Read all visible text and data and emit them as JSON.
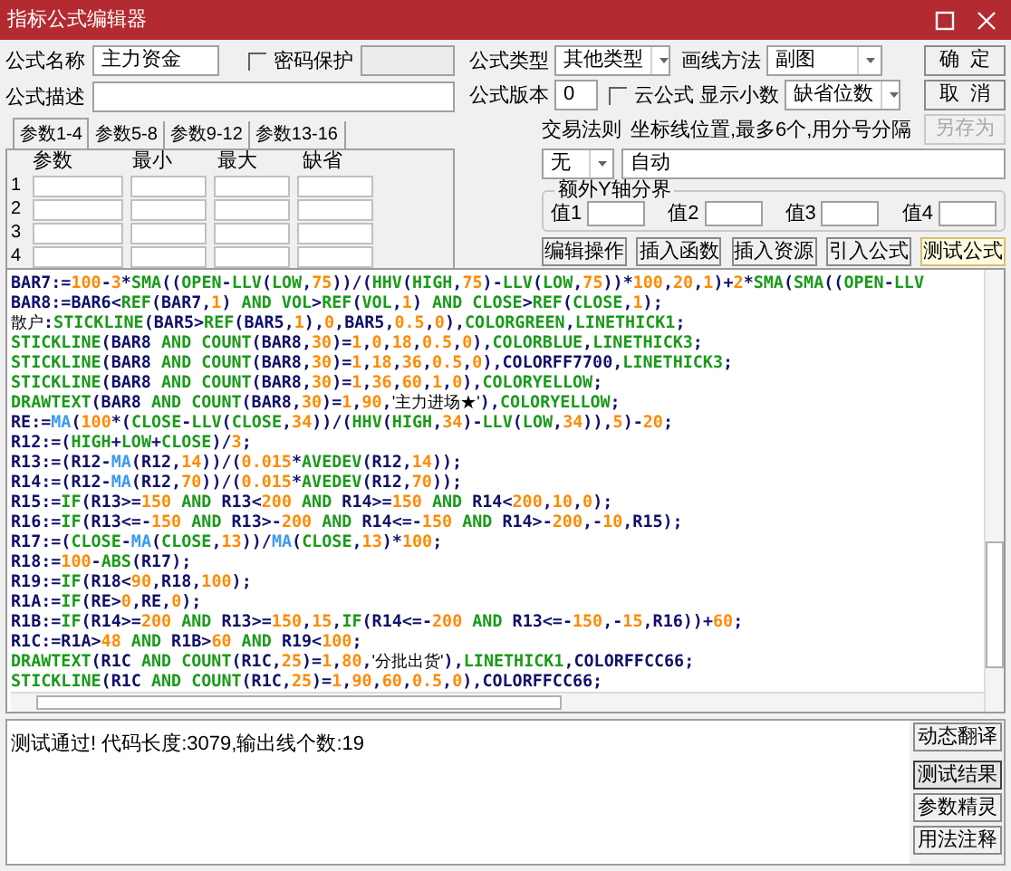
{
  "window": {
    "title": "指标公式编辑器"
  },
  "form": {
    "name_label": "公式名称",
    "name_value": "主力资金",
    "password": {
      "label": "密码保护",
      "checked": false
    },
    "desc_label": "公式描述",
    "type_label": "公式类型",
    "type_value": "其他类型",
    "draw_label": "画线方法",
    "draw_value": "副图",
    "version_label": "公式版本",
    "version_value": "0",
    "cloud": {
      "label": "云公式",
      "checked": false
    },
    "decimal_label": "显示小数",
    "decimal_value": "缺省位数",
    "trade_label": "交易法则",
    "trade_value": "无",
    "axis_label": "坐标线位置,最多6个,用分号分隔",
    "axis_value": "自动",
    "yaxis_title": "额外Y轴分界",
    "yaxis_values": [
      "值1",
      "值2",
      "值3",
      "值4"
    ]
  },
  "side_buttons": [
    {
      "label": "确  定",
      "disabled": false
    },
    {
      "label": "取  消",
      "disabled": false
    },
    {
      "label": "另存为",
      "disabled": true
    }
  ],
  "tabs": [
    {
      "label": "参数1-4",
      "selected": true
    },
    {
      "label": "参数5-8",
      "selected": false
    },
    {
      "label": "参数9-12",
      "selected": false
    },
    {
      "label": "参数13-16",
      "selected": false
    }
  ],
  "params": {
    "columns": [
      "参数",
      "最小",
      "最大",
      "缺省"
    ],
    "rows": [
      "1",
      "2",
      "3",
      "4"
    ]
  },
  "tool_buttons": [
    {
      "label": "编辑操作",
      "selected": false
    },
    {
      "label": "插入函数",
      "selected": false
    },
    {
      "label": "插入资源",
      "selected": false
    },
    {
      "label": "引入公式",
      "selected": false
    },
    {
      "label": "测试公式",
      "selected": true
    }
  ],
  "code": [
    [
      {
        "kind": "plain",
        "text": "BAR7:="
      },
      {
        "kind": "num",
        "text": "100"
      },
      {
        "kind": "plain",
        "text": "-"
      },
      {
        "kind": "num",
        "text": "3"
      },
      {
        "kind": "plain",
        "text": "*"
      },
      {
        "kind": "func",
        "text": "SMA"
      },
      {
        "kind": "plain",
        "text": "(("
      },
      {
        "kind": "func",
        "text": "OPEN"
      },
      {
        "kind": "plain",
        "text": "-"
      },
      {
        "kind": "func",
        "text": "LLV"
      },
      {
        "kind": "plain",
        "text": "("
      },
      {
        "kind": "func",
        "text": "LOW"
      },
      {
        "kind": "plain",
        "text": ","
      },
      {
        "kind": "num",
        "text": "75"
      },
      {
        "kind": "plain",
        "text": "))/("
      },
      {
        "kind": "func",
        "text": "HHV"
      },
      {
        "kind": "plain",
        "text": "("
      },
      {
        "kind": "func",
        "text": "HIGH"
      },
      {
        "kind": "plain",
        "text": ","
      },
      {
        "kind": "num",
        "text": "75"
      },
      {
        "kind": "plain",
        "text": ")-"
      },
      {
        "kind": "func",
        "text": "LLV"
      },
      {
        "kind": "plain",
        "text": "("
      },
      {
        "kind": "func",
        "text": "LOW"
      },
      {
        "kind": "plain",
        "text": ","
      },
      {
        "kind": "num",
        "text": "75"
      },
      {
        "kind": "plain",
        "text": "))*"
      },
      {
        "kind": "num",
        "text": "100"
      },
      {
        "kind": "plain",
        "text": ","
      },
      {
        "kind": "num",
        "text": "20"
      },
      {
        "kind": "plain",
        "text": ","
      },
      {
        "kind": "num",
        "text": "1"
      },
      {
        "kind": "plain",
        "text": ")+"
      },
      {
        "kind": "num",
        "text": "2"
      },
      {
        "kind": "plain",
        "text": "*"
      },
      {
        "kind": "func",
        "text": "SMA"
      },
      {
        "kind": "plain",
        "text": "("
      },
      {
        "kind": "func",
        "text": "SMA"
      },
      {
        "kind": "plain",
        "text": "(("
      },
      {
        "kind": "func",
        "text": "OPEN"
      },
      {
        "kind": "plain",
        "text": "-"
      },
      {
        "kind": "func",
        "text": "LLV"
      }
    ],
    [
      {
        "kind": "plain",
        "text": "BAR8:=BAR6<"
      },
      {
        "kind": "func",
        "text": "REF"
      },
      {
        "kind": "plain",
        "text": "(BAR7,"
      },
      {
        "kind": "num",
        "text": "1"
      },
      {
        "kind": "plain",
        "text": ") "
      },
      {
        "kind": "func",
        "text": "AND VOL"
      },
      {
        "kind": "plain",
        "text": ">"
      },
      {
        "kind": "func",
        "text": "REF"
      },
      {
        "kind": "plain",
        "text": "("
      },
      {
        "kind": "func",
        "text": "VOL"
      },
      {
        "kind": "plain",
        "text": ","
      },
      {
        "kind": "num",
        "text": "1"
      },
      {
        "kind": "plain",
        "text": ") "
      },
      {
        "kind": "func",
        "text": "AND CLOSE"
      },
      {
        "kind": "plain",
        "text": ">"
      },
      {
        "kind": "func",
        "text": "REF"
      },
      {
        "kind": "plain",
        "text": "("
      },
      {
        "kind": "func",
        "text": "CLOSE"
      },
      {
        "kind": "plain",
        "text": ","
      },
      {
        "kind": "num",
        "text": "1"
      },
      {
        "kind": "plain",
        "text": ");"
      }
    ],
    [
      {
        "kind": "str",
        "text": "散户"
      },
      {
        "kind": "plain",
        "text": ":"
      },
      {
        "kind": "func",
        "text": "STICKLINE"
      },
      {
        "kind": "plain",
        "text": "(BAR5>"
      },
      {
        "kind": "func",
        "text": "REF"
      },
      {
        "kind": "plain",
        "text": "(BAR5,"
      },
      {
        "kind": "num",
        "text": "1"
      },
      {
        "kind": "plain",
        "text": "),"
      },
      {
        "kind": "num",
        "text": "0"
      },
      {
        "kind": "plain",
        "text": ",BAR5,"
      },
      {
        "kind": "num",
        "text": "0.5"
      },
      {
        "kind": "plain",
        "text": ","
      },
      {
        "kind": "num",
        "text": "0"
      },
      {
        "kind": "plain",
        "text": "),"
      },
      {
        "kind": "func",
        "text": "COLORGREEN"
      },
      {
        "kind": "plain",
        "text": ","
      },
      {
        "kind": "func",
        "text": "LINETHICK1"
      },
      {
        "kind": "plain",
        "text": ";"
      }
    ],
    [
      {
        "kind": "func",
        "text": "STICKLINE"
      },
      {
        "kind": "plain",
        "text": "(BAR8 "
      },
      {
        "kind": "func",
        "text": "AND COUNT"
      },
      {
        "kind": "plain",
        "text": "(BAR8,"
      },
      {
        "kind": "num",
        "text": "30"
      },
      {
        "kind": "plain",
        "text": ")="
      },
      {
        "kind": "num",
        "text": "1"
      },
      {
        "kind": "plain",
        "text": ","
      },
      {
        "kind": "num",
        "text": "0"
      },
      {
        "kind": "plain",
        "text": ","
      },
      {
        "kind": "num",
        "text": "18"
      },
      {
        "kind": "plain",
        "text": ","
      },
      {
        "kind": "num",
        "text": "0.5"
      },
      {
        "kind": "plain",
        "text": ","
      },
      {
        "kind": "num",
        "text": "0"
      },
      {
        "kind": "plain",
        "text": "),"
      },
      {
        "kind": "func",
        "text": "COLORBLUE"
      },
      {
        "kind": "plain",
        "text": ","
      },
      {
        "kind": "func",
        "text": "LINETHICK3"
      },
      {
        "kind": "plain",
        "text": ";"
      }
    ],
    [
      {
        "kind": "func",
        "text": "STICKLINE"
      },
      {
        "kind": "plain",
        "text": "(BAR8 "
      },
      {
        "kind": "func",
        "text": "AND COUNT"
      },
      {
        "kind": "plain",
        "text": "(BAR8,"
      },
      {
        "kind": "num",
        "text": "30"
      },
      {
        "kind": "plain",
        "text": ")="
      },
      {
        "kind": "num",
        "text": "1"
      },
      {
        "kind": "plain",
        "text": ","
      },
      {
        "kind": "num",
        "text": "18"
      },
      {
        "kind": "plain",
        "text": ","
      },
      {
        "kind": "num",
        "text": "36"
      },
      {
        "kind": "plain",
        "text": ","
      },
      {
        "kind": "num",
        "text": "0.5"
      },
      {
        "kind": "plain",
        "text": ","
      },
      {
        "kind": "num",
        "text": "0"
      },
      {
        "kind": "plain",
        "text": "),COLORFF7700,"
      },
      {
        "kind": "func",
        "text": "LINETHICK3"
      },
      {
        "kind": "plain",
        "text": ";"
      }
    ],
    [
      {
        "kind": "func",
        "text": "STICKLINE"
      },
      {
        "kind": "plain",
        "text": "(BAR8 "
      },
      {
        "kind": "func",
        "text": "AND COUNT"
      },
      {
        "kind": "plain",
        "text": "(BAR8,"
      },
      {
        "kind": "num",
        "text": "30"
      },
      {
        "kind": "plain",
        "text": ")="
      },
      {
        "kind": "num",
        "text": "1"
      },
      {
        "kind": "plain",
        "text": ","
      },
      {
        "kind": "num",
        "text": "36"
      },
      {
        "kind": "plain",
        "text": ","
      },
      {
        "kind": "num",
        "text": "60"
      },
      {
        "kind": "plain",
        "text": ","
      },
      {
        "kind": "num",
        "text": "1"
      },
      {
        "kind": "plain",
        "text": ","
      },
      {
        "kind": "num",
        "text": "0"
      },
      {
        "kind": "plain",
        "text": "),"
      },
      {
        "kind": "func",
        "text": "COLORYELLOW"
      },
      {
        "kind": "plain",
        "text": ";"
      }
    ],
    [
      {
        "kind": "func",
        "text": "DRAWTEXT"
      },
      {
        "kind": "plain",
        "text": "(BAR8 "
      },
      {
        "kind": "func",
        "text": "AND COUNT"
      },
      {
        "kind": "plain",
        "text": "(BAR8,"
      },
      {
        "kind": "num",
        "text": "30"
      },
      {
        "kind": "plain",
        "text": ")="
      },
      {
        "kind": "num",
        "text": "1"
      },
      {
        "kind": "plain",
        "text": ","
      },
      {
        "kind": "num",
        "text": "90"
      },
      {
        "kind": "plain",
        "text": ","
      },
      {
        "kind": "str",
        "text": "'主力进场★'"
      },
      {
        "kind": "plain",
        "text": "),"
      },
      {
        "kind": "func",
        "text": "COLORYELLOW"
      },
      {
        "kind": "plain",
        "text": ";"
      }
    ],
    [
      {
        "kind": "plain",
        "text": "RE:="
      },
      {
        "kind": "ma",
        "text": "MA"
      },
      {
        "kind": "plain",
        "text": "("
      },
      {
        "kind": "num",
        "text": "100"
      },
      {
        "kind": "plain",
        "text": "*("
      },
      {
        "kind": "func",
        "text": "CLOSE"
      },
      {
        "kind": "plain",
        "text": "-"
      },
      {
        "kind": "func",
        "text": "LLV"
      },
      {
        "kind": "plain",
        "text": "("
      },
      {
        "kind": "func",
        "text": "CLOSE"
      },
      {
        "kind": "plain",
        "text": ","
      },
      {
        "kind": "num",
        "text": "34"
      },
      {
        "kind": "plain",
        "text": "))/("
      },
      {
        "kind": "func",
        "text": "HHV"
      },
      {
        "kind": "plain",
        "text": "("
      },
      {
        "kind": "func",
        "text": "HIGH"
      },
      {
        "kind": "plain",
        "text": ","
      },
      {
        "kind": "num",
        "text": "34"
      },
      {
        "kind": "plain",
        "text": ")-"
      },
      {
        "kind": "func",
        "text": "LLV"
      },
      {
        "kind": "plain",
        "text": "("
      },
      {
        "kind": "func",
        "text": "LOW"
      },
      {
        "kind": "plain",
        "text": ","
      },
      {
        "kind": "num",
        "text": "34"
      },
      {
        "kind": "plain",
        "text": ")),"
      },
      {
        "kind": "num",
        "text": "5"
      },
      {
        "kind": "plain",
        "text": ")-"
      },
      {
        "kind": "num",
        "text": "20"
      },
      {
        "kind": "plain",
        "text": ";"
      }
    ],
    [
      {
        "kind": "plain",
        "text": "R12:=("
      },
      {
        "kind": "func",
        "text": "HIGH"
      },
      {
        "kind": "plain",
        "text": "+"
      },
      {
        "kind": "func",
        "text": "LOW"
      },
      {
        "kind": "plain",
        "text": "+"
      },
      {
        "kind": "func",
        "text": "CLOSE"
      },
      {
        "kind": "plain",
        "text": ")/"
      },
      {
        "kind": "num",
        "text": "3"
      },
      {
        "kind": "plain",
        "text": ";"
      }
    ],
    [
      {
        "kind": "plain",
        "text": "R13:=(R12-"
      },
      {
        "kind": "ma",
        "text": "MA"
      },
      {
        "kind": "plain",
        "text": "(R12,"
      },
      {
        "kind": "num",
        "text": "14"
      },
      {
        "kind": "plain",
        "text": "))/("
      },
      {
        "kind": "num",
        "text": "0.015"
      },
      {
        "kind": "plain",
        "text": "*"
      },
      {
        "kind": "func",
        "text": "AVEDEV"
      },
      {
        "kind": "plain",
        "text": "(R12,"
      },
      {
        "kind": "num",
        "text": "14"
      },
      {
        "kind": "plain",
        "text": "));"
      }
    ],
    [
      {
        "kind": "plain",
        "text": "R14:=(R12-"
      },
      {
        "kind": "ma",
        "text": "MA"
      },
      {
        "kind": "plain",
        "text": "(R12,"
      },
      {
        "kind": "num",
        "text": "70"
      },
      {
        "kind": "plain",
        "text": "))/("
      },
      {
        "kind": "num",
        "text": "0.015"
      },
      {
        "kind": "plain",
        "text": "*"
      },
      {
        "kind": "func",
        "text": "AVEDEV"
      },
      {
        "kind": "plain",
        "text": "(R12,"
      },
      {
        "kind": "num",
        "text": "70"
      },
      {
        "kind": "plain",
        "text": "));"
      }
    ],
    [
      {
        "kind": "plain",
        "text": "R15:="
      },
      {
        "kind": "func",
        "text": "IF"
      },
      {
        "kind": "plain",
        "text": "(R13>="
      },
      {
        "kind": "num",
        "text": "150"
      },
      {
        "kind": "func",
        "text": " AND"
      },
      {
        "kind": "plain",
        "text": " R13<"
      },
      {
        "kind": "num",
        "text": "200"
      },
      {
        "kind": "func",
        "text": " AND"
      },
      {
        "kind": "plain",
        "text": " R14>="
      },
      {
        "kind": "num",
        "text": "150"
      },
      {
        "kind": "func",
        "text": " AND"
      },
      {
        "kind": "plain",
        "text": " R14<"
      },
      {
        "kind": "num",
        "text": "200"
      },
      {
        "kind": "plain",
        "text": ","
      },
      {
        "kind": "num",
        "text": "10"
      },
      {
        "kind": "plain",
        "text": ","
      },
      {
        "kind": "num",
        "text": "0"
      },
      {
        "kind": "plain",
        "text": ");"
      }
    ],
    [
      {
        "kind": "plain",
        "text": "R16:="
      },
      {
        "kind": "func",
        "text": "IF"
      },
      {
        "kind": "plain",
        "text": "(R13<=-"
      },
      {
        "kind": "num",
        "text": "150"
      },
      {
        "kind": "func",
        "text": " AND"
      },
      {
        "kind": "plain",
        "text": " R13>-"
      },
      {
        "kind": "num",
        "text": "200"
      },
      {
        "kind": "func",
        "text": " AND"
      },
      {
        "kind": "plain",
        "text": " R14<=-"
      },
      {
        "kind": "num",
        "text": "150"
      },
      {
        "kind": "func",
        "text": " AND"
      },
      {
        "kind": "plain",
        "text": " R14>-"
      },
      {
        "kind": "num",
        "text": "200"
      },
      {
        "kind": "plain",
        "text": ",-"
      },
      {
        "kind": "num",
        "text": "10"
      },
      {
        "kind": "plain",
        "text": ",R15);"
      }
    ],
    [
      {
        "kind": "plain",
        "text": "R17:=("
      },
      {
        "kind": "func",
        "text": "CLOSE"
      },
      {
        "kind": "plain",
        "text": "-"
      },
      {
        "kind": "ma",
        "text": "MA"
      },
      {
        "kind": "plain",
        "text": "("
      },
      {
        "kind": "func",
        "text": "CLOSE"
      },
      {
        "kind": "plain",
        "text": ","
      },
      {
        "kind": "num",
        "text": "13"
      },
      {
        "kind": "plain",
        "text": "))/"
      },
      {
        "kind": "ma",
        "text": "MA"
      },
      {
        "kind": "plain",
        "text": "("
      },
      {
        "kind": "func",
        "text": "CLOSE"
      },
      {
        "kind": "plain",
        "text": ","
      },
      {
        "kind": "num",
        "text": "13"
      },
      {
        "kind": "plain",
        "text": ")*"
      },
      {
        "kind": "num",
        "text": "100"
      },
      {
        "kind": "plain",
        "text": ";"
      }
    ],
    [
      {
        "kind": "plain",
        "text": "R18:="
      },
      {
        "kind": "num",
        "text": "100"
      },
      {
        "kind": "plain",
        "text": "-"
      },
      {
        "kind": "func",
        "text": "ABS"
      },
      {
        "kind": "plain",
        "text": "(R17);"
      }
    ],
    [
      {
        "kind": "plain",
        "text": "R19:="
      },
      {
        "kind": "func",
        "text": "IF"
      },
      {
        "kind": "plain",
        "text": "(R18<"
      },
      {
        "kind": "num",
        "text": "90"
      },
      {
        "kind": "plain",
        "text": ",R18,"
      },
      {
        "kind": "num",
        "text": "100"
      },
      {
        "kind": "plain",
        "text": ");"
      }
    ],
    [
      {
        "kind": "plain",
        "text": "R1A:="
      },
      {
        "kind": "func",
        "text": "IF"
      },
      {
        "kind": "plain",
        "text": "(RE>"
      },
      {
        "kind": "num",
        "text": "0"
      },
      {
        "kind": "plain",
        "text": ",RE,"
      },
      {
        "kind": "num",
        "text": "0"
      },
      {
        "kind": "plain",
        "text": ");"
      }
    ],
    [
      {
        "kind": "plain",
        "text": "R1B:="
      },
      {
        "kind": "func",
        "text": "IF"
      },
      {
        "kind": "plain",
        "text": "(R14>="
      },
      {
        "kind": "num",
        "text": "200"
      },
      {
        "kind": "func",
        "text": " AND"
      },
      {
        "kind": "plain",
        "text": " R13>="
      },
      {
        "kind": "num",
        "text": "150"
      },
      {
        "kind": "plain",
        "text": ","
      },
      {
        "kind": "num",
        "text": "15"
      },
      {
        "kind": "plain",
        "text": ","
      },
      {
        "kind": "func",
        "text": "IF"
      },
      {
        "kind": "plain",
        "text": "(R14<=-"
      },
      {
        "kind": "num",
        "text": "200"
      },
      {
        "kind": "func",
        "text": " AND"
      },
      {
        "kind": "plain",
        "text": " R13<=-"
      },
      {
        "kind": "num",
        "text": "150"
      },
      {
        "kind": "plain",
        "text": ",-"
      },
      {
        "kind": "num",
        "text": "15"
      },
      {
        "kind": "plain",
        "text": ",R16))+"
      },
      {
        "kind": "num",
        "text": "60"
      },
      {
        "kind": "plain",
        "text": ";"
      }
    ],
    [
      {
        "kind": "plain",
        "text": "R1C:=R1A>"
      },
      {
        "kind": "num",
        "text": "48"
      },
      {
        "kind": "func",
        "text": " AND"
      },
      {
        "kind": "plain",
        "text": " R1B>"
      },
      {
        "kind": "num",
        "text": "60"
      },
      {
        "kind": "func",
        "text": " AND"
      },
      {
        "kind": "plain",
        "text": " R19<"
      },
      {
        "kind": "num",
        "text": "100"
      },
      {
        "kind": "plain",
        "text": ";"
      }
    ],
    [
      {
        "kind": "func",
        "text": "DRAWTEXT"
      },
      {
        "kind": "plain",
        "text": "(R1C "
      },
      {
        "kind": "func",
        "text": "AND COUNT"
      },
      {
        "kind": "plain",
        "text": "(R1C,"
      },
      {
        "kind": "num",
        "text": "25"
      },
      {
        "kind": "plain",
        "text": ")="
      },
      {
        "kind": "num",
        "text": "1"
      },
      {
        "kind": "plain",
        "text": ","
      },
      {
        "kind": "num",
        "text": "80"
      },
      {
        "kind": "plain",
        "text": ","
      },
      {
        "kind": "str",
        "text": "'分批出货'"
      },
      {
        "kind": "plain",
        "text": "),"
      },
      {
        "kind": "func",
        "text": "LINETHICK1"
      },
      {
        "kind": "plain",
        "text": ",COLORFFCC66;"
      }
    ],
    [
      {
        "kind": "func",
        "text": "STICKLINE"
      },
      {
        "kind": "plain",
        "text": "(R1C "
      },
      {
        "kind": "func",
        "text": "AND COUNT"
      },
      {
        "kind": "plain",
        "text": "(R1C,"
      },
      {
        "kind": "num",
        "text": "25"
      },
      {
        "kind": "plain",
        "text": ")="
      },
      {
        "kind": "num",
        "text": "1"
      },
      {
        "kind": "plain",
        "text": ","
      },
      {
        "kind": "num",
        "text": "90"
      },
      {
        "kind": "plain",
        "text": ","
      },
      {
        "kind": "num",
        "text": "60"
      },
      {
        "kind": "plain",
        "text": ","
      },
      {
        "kind": "num",
        "text": "0.5"
      },
      {
        "kind": "plain",
        "text": ","
      },
      {
        "kind": "num",
        "text": "0"
      },
      {
        "kind": "plain",
        "text": "),COLORFFCC66;"
      }
    ]
  ],
  "status": {
    "message": "测试通过! 代码长度:3079,输出线个数:19"
  },
  "status_buttons": [
    {
      "label": "动态翻译",
      "selected": false
    },
    {
      "label": "测试结果",
      "selected": true
    },
    {
      "label": "参数精灵",
      "selected": false
    },
    {
      "label": "用法注释",
      "selected": false
    }
  ]
}
